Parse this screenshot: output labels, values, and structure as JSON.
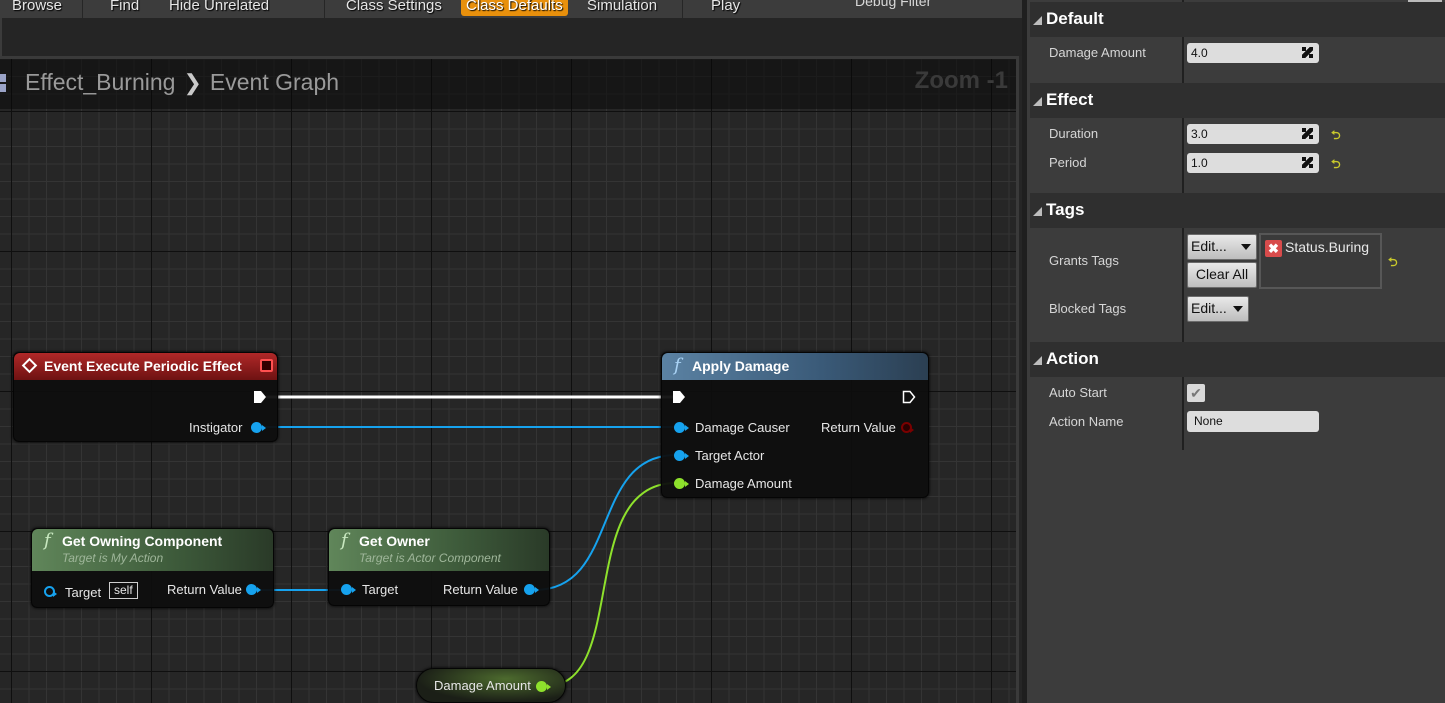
{
  "toolbar": {
    "items": [
      {
        "label": "Browse",
        "active": false
      },
      {
        "label": "Find",
        "active": false
      },
      {
        "label": "Hide Unrelated",
        "active": false
      },
      {
        "label": "Class Settings",
        "active": false
      },
      {
        "label": "Class Defaults",
        "active": true
      },
      {
        "label": "Simulation",
        "active": false
      },
      {
        "label": "Play",
        "active": false
      }
    ],
    "debug_filter_label": "Debug Filter",
    "accent_color": "#e8900c"
  },
  "graph": {
    "breadcrumb": [
      "Effect_Burning",
      "Event Graph"
    ],
    "zoom_label": "Zoom -1",
    "nodes": {
      "event": {
        "title": "Event Execute Periodic Effect",
        "outputs": [
          "Instigator"
        ]
      },
      "apply_damage": {
        "title": "Apply Damage",
        "inputs": [
          "Damage Causer",
          "Target Actor",
          "Damage Amount"
        ],
        "outputs": [
          "Return Value"
        ]
      },
      "get_owning_component": {
        "title": "Get Owning Component",
        "subtitle": "Target is My Action",
        "inputs": [
          "Target"
        ],
        "default_value": "self",
        "outputs": [
          "Return Value"
        ]
      },
      "get_owner": {
        "title": "Get Owner",
        "subtitle": "Target is Actor Component",
        "inputs": [
          "Target"
        ],
        "outputs": [
          "Return Value"
        ]
      },
      "damage_amount_var": {
        "label": "Damage Amount"
      }
    },
    "colors": {
      "object_pin": "#16a2ee",
      "float_pin": "#8ee12c",
      "exec_wire": "#ffffff",
      "event_header": "#b02828",
      "function_header": "#5b82a3",
      "pure_header": "#60865a"
    }
  },
  "details": {
    "categories": [
      {
        "name": "Default",
        "properties": [
          {
            "label": "Damage Amount",
            "value": "4.0"
          }
        ]
      },
      {
        "name": "Effect",
        "properties": [
          {
            "label": "Duration",
            "value": "3.0"
          },
          {
            "label": "Period",
            "value": "1.0"
          }
        ]
      },
      {
        "name": "Tags",
        "properties": [
          {
            "label": "Grants Tags",
            "edit_label": "Edit...",
            "clear_label": "Clear All",
            "tags": [
              "Status.Buring"
            ]
          },
          {
            "label": "Blocked Tags",
            "edit_label": "Edit..."
          }
        ]
      },
      {
        "name": "Action",
        "properties": [
          {
            "label": "Auto Start",
            "checked": true
          },
          {
            "label": "Action Name",
            "value": "None"
          }
        ]
      }
    ],
    "reset_glyph": "⮌"
  }
}
